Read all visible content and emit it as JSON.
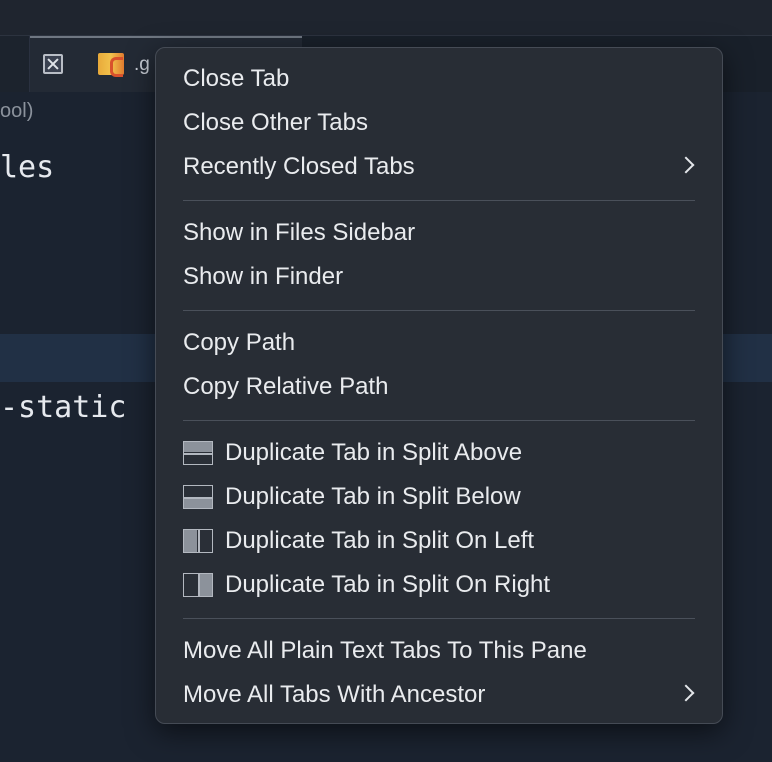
{
  "background": {
    "tab_name": ".g",
    "breadcrumb_tail": "ool)",
    "code_line_1": "les",
    "code_line_2": "-static"
  },
  "menu": {
    "items": [
      {
        "label": "Close Tab"
      },
      {
        "label": "Close Other Tabs"
      },
      {
        "label": "Recently Closed Tabs",
        "submenu": true
      },
      {
        "label": "Show in Files Sidebar"
      },
      {
        "label": "Show in Finder"
      },
      {
        "label": "Copy Path"
      },
      {
        "label": "Copy Relative Path"
      },
      {
        "label": "Duplicate Tab in Split Above",
        "icon": "split-above-icon"
      },
      {
        "label": "Duplicate Tab in Split Below",
        "icon": "split-below-icon"
      },
      {
        "label": "Duplicate Tab in Split On Left",
        "icon": "split-left-icon"
      },
      {
        "label": "Duplicate Tab in Split On Right",
        "icon": "split-right-icon"
      },
      {
        "label": "Move All Plain Text Tabs To This Pane"
      },
      {
        "label": "Move All Tabs With Ancestor",
        "submenu": true
      }
    ]
  },
  "colors": {
    "menu_bg": "#282d35",
    "menu_text": "#e9ebee",
    "separator": "#4a505a",
    "editor_bg": "#1b2330"
  }
}
